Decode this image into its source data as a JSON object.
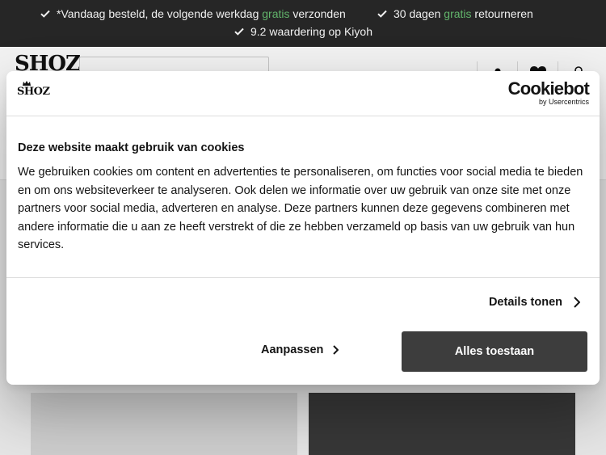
{
  "usp_bar": {
    "items": [
      {
        "before": "*Vandaag besteld, de volgende werkdag ",
        "highlight": "gratis",
        "after": " verzonden"
      },
      {
        "before": "30 dagen ",
        "highlight": "gratis",
        "after": " retourneren"
      },
      {
        "before": "9.2 waardering op Kiyoh",
        "highlight": "",
        "after": ""
      }
    ]
  },
  "header": {
    "logo": "SHOZ",
    "icons": [
      "user-icon",
      "heart-icon",
      "bag-icon"
    ]
  },
  "cookie_dialog": {
    "logo": "SHOZ",
    "brand_name": "Cookiebot",
    "brand_sub": "by Usercentrics",
    "title": "Deze website maakt gebruik van cookies",
    "body": "We gebruiken cookies om content en advertenties te personaliseren, om functies voor social media te bieden en om ons websiteverkeer te analyseren. Ook delen we informatie over uw gebruik van onze site met onze partners voor social media, adverteren en analyse. Deze partners kunnen deze gegevens combineren met andere informatie die u aan ze heeft verstrekt of die ze hebben verzameld op basis van uw gebruik van hun services.",
    "details_label": "Details tonen",
    "customize_label": "Aanpassen",
    "allow_all_label": "Alles toestaan"
  },
  "colors": {
    "usp_bg": "#262626",
    "highlight_green": "#62b46b",
    "primary_button": "#3d3d3d"
  }
}
